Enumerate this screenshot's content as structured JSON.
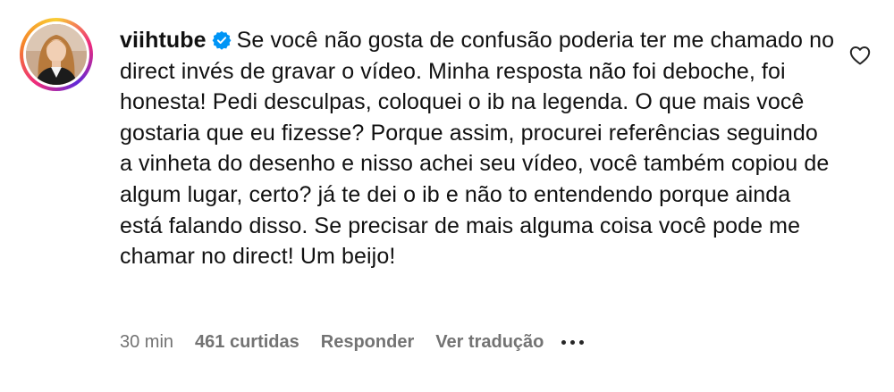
{
  "comment": {
    "username": "viihtube",
    "verified": true,
    "text": "Se você não gosta de confusão poderia ter me chamado no direct invés de gravar o vídeo. Minha resposta não foi deboche, foi honesta! Pedi desculpas, coloquei o ib na legenda. O que mais você gostaria que eu fizesse? Porque assim, procurei referências seguindo a vinheta do desenho e nisso achei seu vídeo, você também copiou de algum lugar, certo? já te dei o ib e não to entendendo porque ainda está falando disso. Se precisar de mais alguma coisa você pode me chamar no direct! Um beijo!",
    "time": "30 min",
    "likes": "461 curtidas",
    "reply_label": "Responder",
    "translate_label": "Ver tradução"
  },
  "icons": {
    "verified": "verified-badge-icon",
    "like": "heart-outline-icon",
    "more": "more-dots-icon",
    "avatar": "profile-picture"
  },
  "colors": {
    "verified_blue": "#0095f6",
    "meta_gray": "#737373",
    "text": "#111111"
  }
}
